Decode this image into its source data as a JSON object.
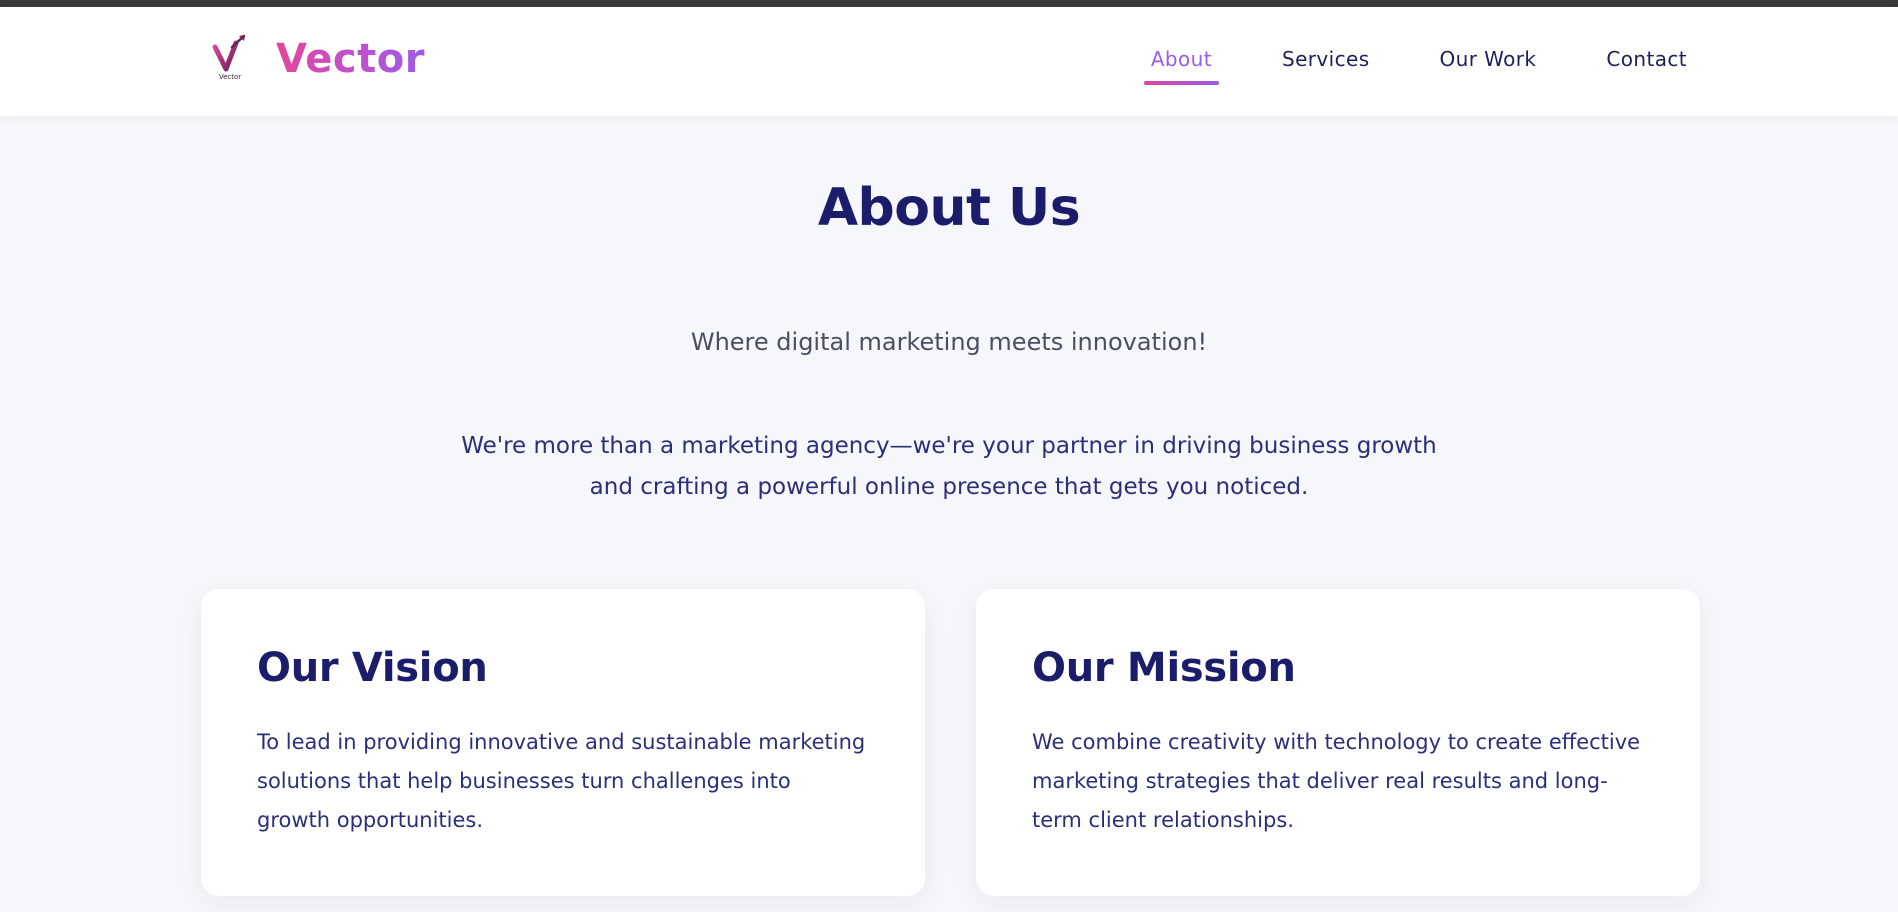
{
  "brand": {
    "name": "Vector",
    "logo_caption": "Vector"
  },
  "nav": {
    "items": [
      {
        "label": "About"
      },
      {
        "label": "Services"
      },
      {
        "label": "Our Work"
      },
      {
        "label": "Contact"
      }
    ],
    "active": "About"
  },
  "about": {
    "title": "About Us",
    "tagline": "Where digital marketing meets innovation!",
    "intro": "We're more than a marketing agency—we're your partner in driving business growth and crafting a powerful online presence that gets you noticed."
  },
  "cards": [
    {
      "title": "Our Vision",
      "text": "To lead in providing innovative and sustainable marketing solutions that help businesses turn challenges into growth opportunities."
    },
    {
      "title": "Our Mission",
      "text": "We combine creativity with technology to create effective marketing strategies that deliver real results and long-term client relationships."
    }
  ],
  "colors": {
    "heading": "#1b1d6b",
    "body_text": "#2b2f7a",
    "nav_active": "#9b5de5",
    "brand_gradient_start": "#e0489c",
    "brand_gradient_end": "#9b5de5",
    "page_background": "#f6f7fa"
  }
}
